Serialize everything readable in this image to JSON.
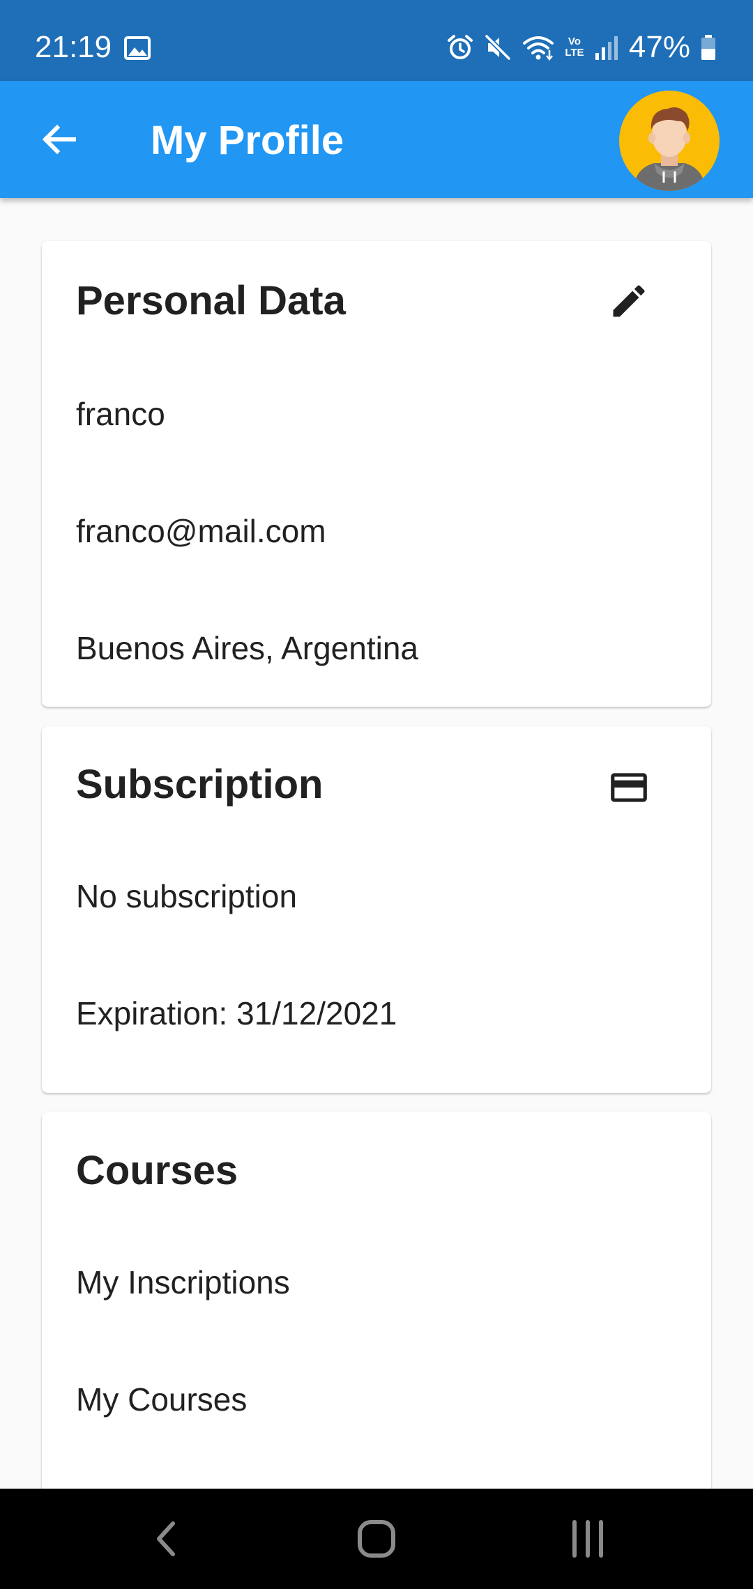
{
  "status_bar": {
    "time": "21:19",
    "battery_percent": "47%",
    "network_label": "Vo LTE",
    "icons": [
      "gallery-icon",
      "alarm-icon",
      "mute-icon",
      "wifi-icon",
      "lte-icon",
      "signal-icon",
      "battery-icon"
    ]
  },
  "app_bar": {
    "title": "My Profile",
    "back_icon": "arrow-back-icon",
    "avatar_icon": "user-avatar"
  },
  "cards": {
    "personal": {
      "title": "Personal Data",
      "icon": "edit-pencil-icon",
      "name": "franco",
      "email": "franco@mail.com",
      "location": "Buenos Aires, Argentina"
    },
    "subscription": {
      "title": "Subscription",
      "icon": "credit-card-icon",
      "status": "No subscription",
      "expiration": "Expiration: 31/12/2021"
    },
    "courses": {
      "title": "Courses",
      "items": [
        "My Inscriptions",
        "My Courses"
      ]
    }
  },
  "nav_bar": {
    "icons": [
      "nav-back-icon",
      "nav-home-icon",
      "nav-recents-icon"
    ]
  },
  "colors": {
    "status_bar": "#1e6fb8",
    "app_bar": "#2196f3",
    "avatar_bg": "#fbbc05",
    "page_bg": "#fafafa",
    "card_bg": "#ffffff",
    "text": "#212121",
    "nav_bar": "#000000"
  }
}
